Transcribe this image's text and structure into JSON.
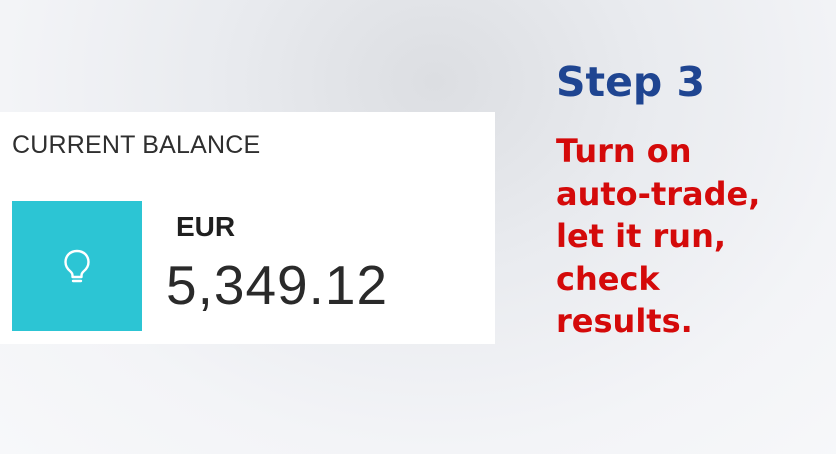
{
  "balance": {
    "heading": "CURRENT BALANCE",
    "currency": "EUR",
    "amount": "5,349.12",
    "icon": "lightbulb-icon",
    "tile_color": "#2cc5d4"
  },
  "step": {
    "title": "Step 3",
    "title_color": "#1f4591",
    "lines": [
      "Turn on",
      "auto-trade,",
      "let it run,",
      "check",
      "results."
    ],
    "text_color": "#d40a0a"
  }
}
